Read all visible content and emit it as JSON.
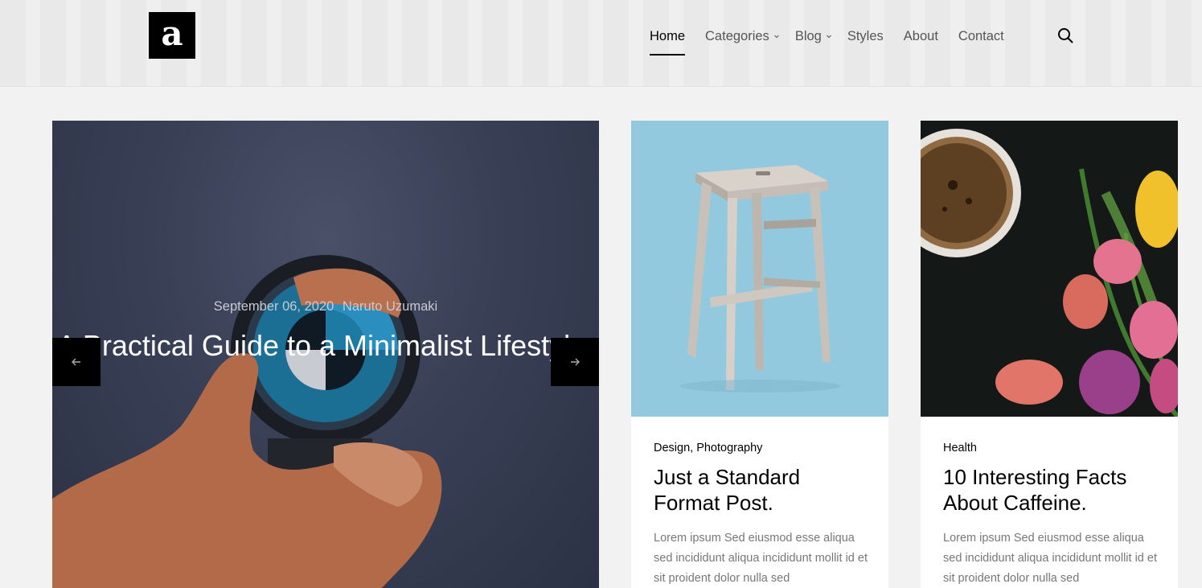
{
  "site": {
    "logo_letter": "a"
  },
  "nav": {
    "items": [
      {
        "label": "Home",
        "active": true,
        "dropdown": false
      },
      {
        "label": "Categories",
        "active": false,
        "dropdown": true
      },
      {
        "label": "Blog",
        "active": false,
        "dropdown": true
      },
      {
        "label": "Styles",
        "active": false,
        "dropdown": false
      },
      {
        "label": "About",
        "active": false,
        "dropdown": false
      },
      {
        "label": "Contact",
        "active": false,
        "dropdown": false
      }
    ],
    "search_icon": "search-icon"
  },
  "hero": {
    "date": "September 06, 2020",
    "author": "Naruto Uzumaki",
    "title": "A Practical Guide to a Minimalist Lifestyle.",
    "prev_icon": "arrow-left-icon",
    "next_icon": "arrow-right-icon"
  },
  "cards": [
    {
      "category": "Design, Photography",
      "title": "Just a Standard Format Post.",
      "excerpt": "Lorem ipsum Sed eiusmod esse aliqua sed incididunt aliqua incididunt mollit id et sit proident dolor nulla sed"
    },
    {
      "category": "Health",
      "title": "10 Interesting Facts About Caffeine.",
      "excerpt": "Lorem ipsum Sed eiusmod esse aliqua sed incididunt aliqua incididunt mollit id et sit proident dolor nulla sed"
    }
  ],
  "colors": {
    "accent": "#000000",
    "hero_bg": "#393f55",
    "card1_bg": "#8ec8e0",
    "card2_bg": "#161a17"
  }
}
